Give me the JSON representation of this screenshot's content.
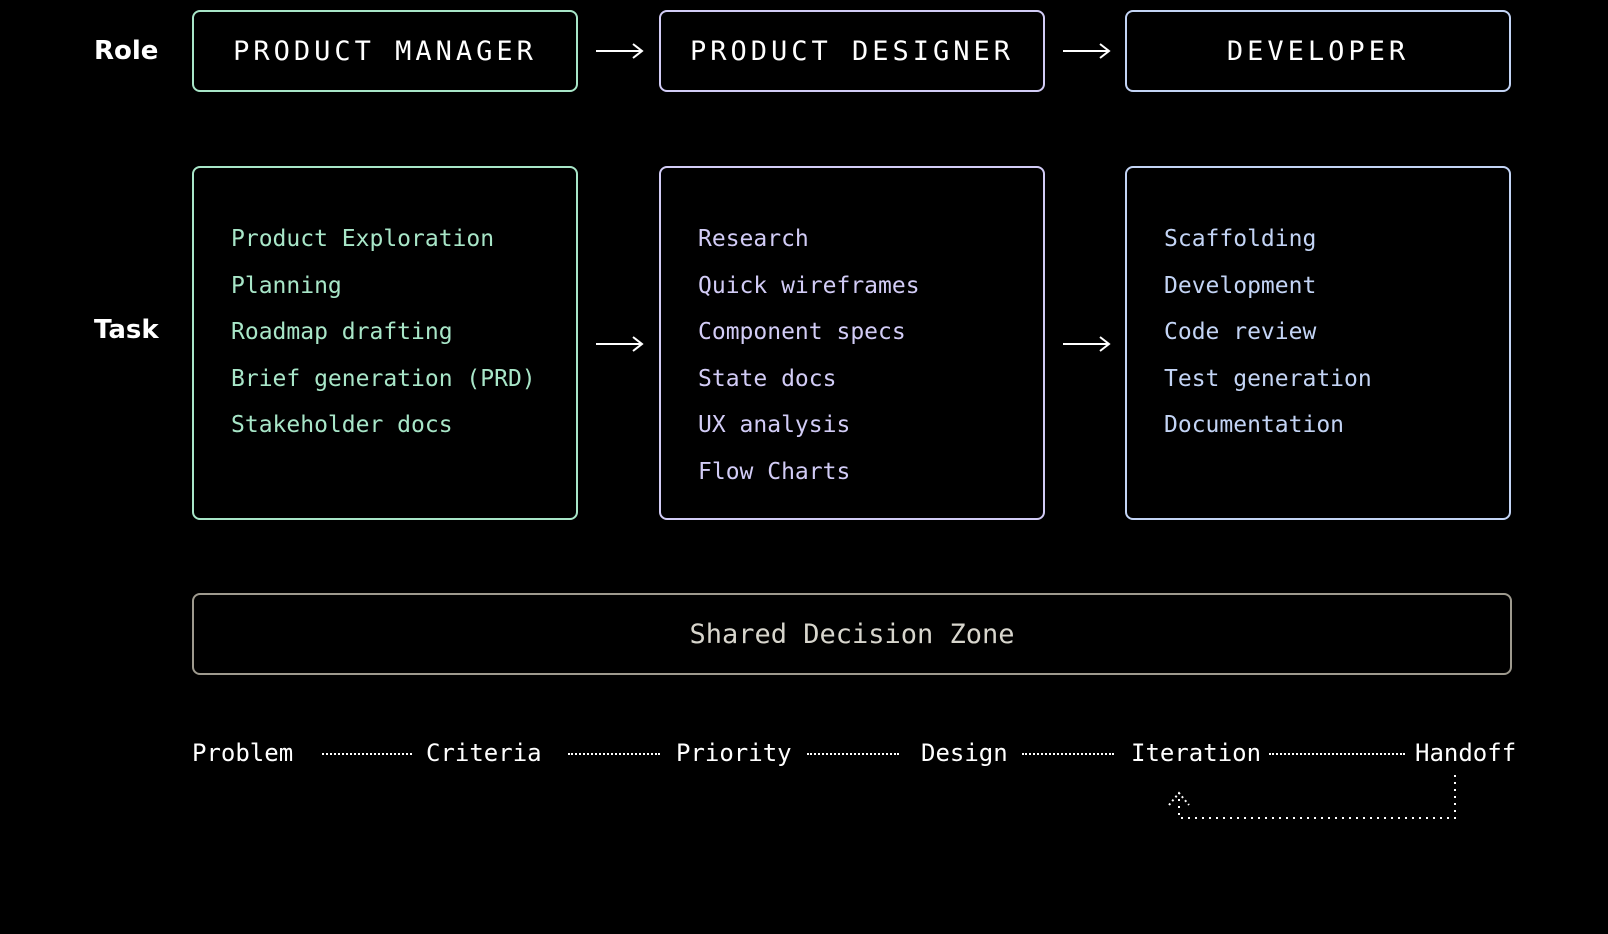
{
  "rows": {
    "role_label": "Role",
    "task_label": "Task"
  },
  "roles": [
    {
      "title": "PRODUCT MANAGER",
      "color": "#a8e6c8"
    },
    {
      "title": "PRODUCT DESIGNER",
      "color": "#d2ccf6"
    },
    {
      "title": "DEVELOPER",
      "color": "#c3d4f5"
    }
  ],
  "tasks": [
    {
      "items": [
        "Product Exploration",
        "Planning",
        "Roadmap drafting",
        "Brief generation (PRD)",
        "Stakeholder docs"
      ]
    },
    {
      "items": [
        "Research",
        "Quick wireframes",
        "Component specs",
        "State docs",
        "UX analysis",
        "Flow Charts"
      ]
    },
    {
      "items": [
        "Scaffolding",
        "Development",
        "Code review",
        "Test generation",
        "Documentation"
      ]
    }
  ],
  "shared_zone": {
    "label": "Shared Decision Zone",
    "border_color": "#9e9a8e"
  },
  "steps": [
    "Problem",
    "Criteria",
    "Priority",
    "Design",
    "Iteration",
    "Handoff"
  ]
}
